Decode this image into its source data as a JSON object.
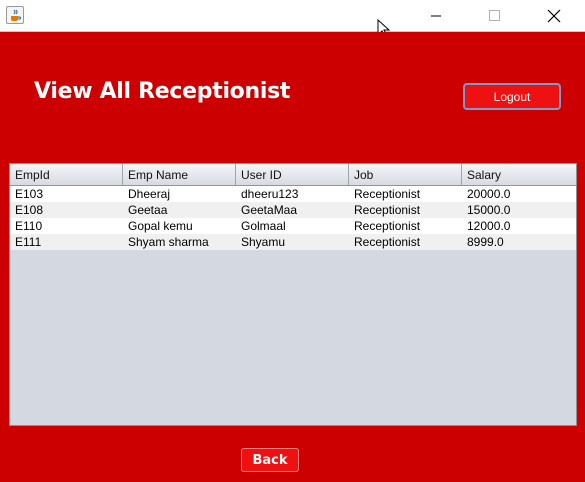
{
  "titlebar": {
    "app_icon": "java-cup-icon",
    "minimize_icon": "minimize-icon",
    "maximize_icon": "maximize-icon",
    "close_icon": "close-icon"
  },
  "header": {
    "title": "View All Receptionist",
    "logout_label": "Logout"
  },
  "table": {
    "columns": [
      "EmpId",
      "Emp Name",
      "User ID",
      "Job",
      "Salary"
    ],
    "rows": [
      [
        "E103",
        "Dheeraj",
        "dheeru123",
        "Receptionist",
        "20000.0"
      ],
      [
        "E108",
        "Geetaa",
        "GeetaMaa",
        "Receptionist",
        "15000.0"
      ],
      [
        "E110",
        "Gopal kemu",
        "Golmaal",
        "Receptionist",
        "12000.0"
      ],
      [
        "E111",
        "Shyam sharma",
        "Shyamu",
        "Receptionist",
        "8999.0"
      ]
    ]
  },
  "footer": {
    "back_label": "Back"
  },
  "colors": {
    "background": "#cc0000",
    "button": "#ee1111",
    "table_empty_area": "#d4d8e0"
  }
}
